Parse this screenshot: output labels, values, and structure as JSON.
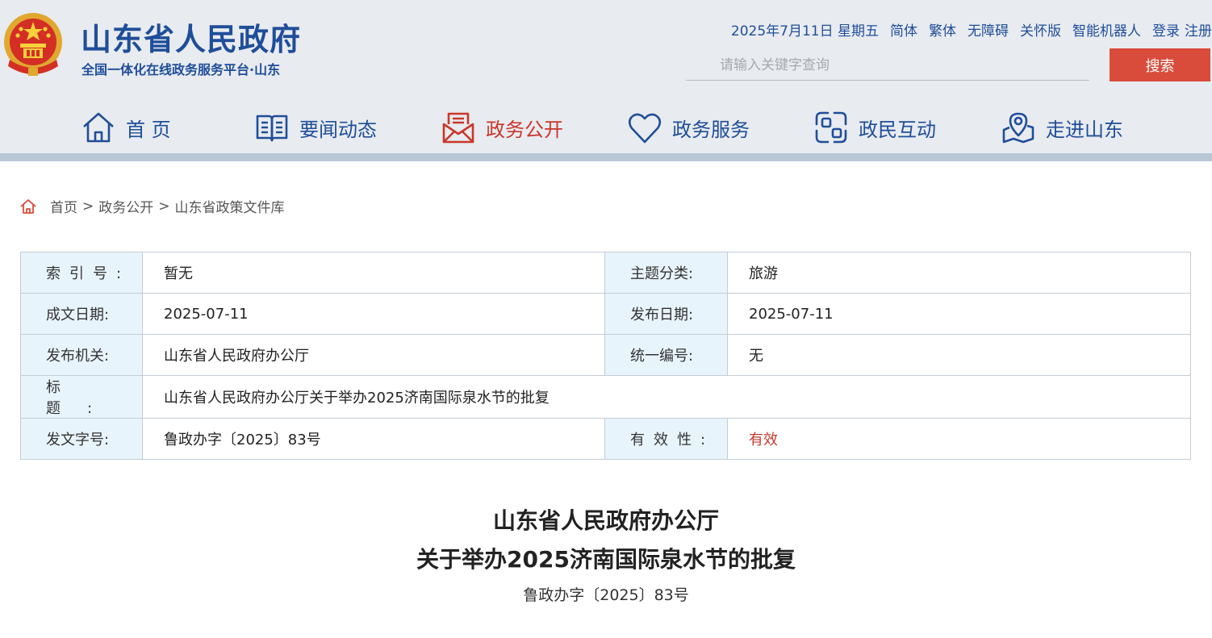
{
  "header": {
    "site_title": "山东省人民政府",
    "site_subtitle": "全国一体化在线政务服务平台·山东",
    "date": "2025年7月11日 星期五",
    "links": [
      "简体",
      "繁体",
      "无障碍",
      "关怀版",
      "智能机器人"
    ],
    "login": "登录",
    "register": "注册",
    "search_placeholder": "请输入关键字查询",
    "search_button": "搜索"
  },
  "nav": {
    "items": [
      {
        "label": "首 页",
        "icon": "home-icon"
      },
      {
        "label": "要闻动态",
        "icon": "book-icon"
      },
      {
        "label": "政务公开",
        "icon": "inbox-mail-icon",
        "active": true
      },
      {
        "label": "政务服务",
        "icon": "heart-icon"
      },
      {
        "label": "政民互动",
        "icon": "interaction-icon"
      },
      {
        "label": "走进山东",
        "icon": "map-pin-icon"
      }
    ]
  },
  "breadcrumb": {
    "items": [
      "首页",
      "政务公开",
      "山东省政策文件库"
    ],
    "separator": ">"
  },
  "meta": {
    "index_no_label": "索引号:",
    "index_no": "暂无",
    "topic_label": "主题分类:",
    "topic": "旅游",
    "written_date_label": "成文日期:",
    "written_date": "2025-07-11",
    "publish_date_label": "发布日期:",
    "publish_date": "2025-07-11",
    "issuer_label": "发布机关:",
    "issuer": "山东省人民政府办公厅",
    "serial_label": "统一编号:",
    "serial": "无",
    "title_label": "标题:",
    "title": "山东省人民政府办公厅关于举办2025济南国际泉水节的批复",
    "doc_no_label": "发文字号:",
    "doc_no": "鲁政办字〔2025〕83号",
    "validity_label": "有效性:",
    "validity": "有效"
  },
  "document": {
    "title_line1": "山东省人民政府办公厅",
    "title_line2": "关于举办2025济南国际泉水节的批复",
    "doc_no": "鲁政办字〔2025〕83号"
  },
  "colors": {
    "brand_blue": "#1f4e99",
    "accent_red": "#d94c3c",
    "label_bg": "#e8f4fc",
    "header_bg": "#e8ebf0"
  }
}
